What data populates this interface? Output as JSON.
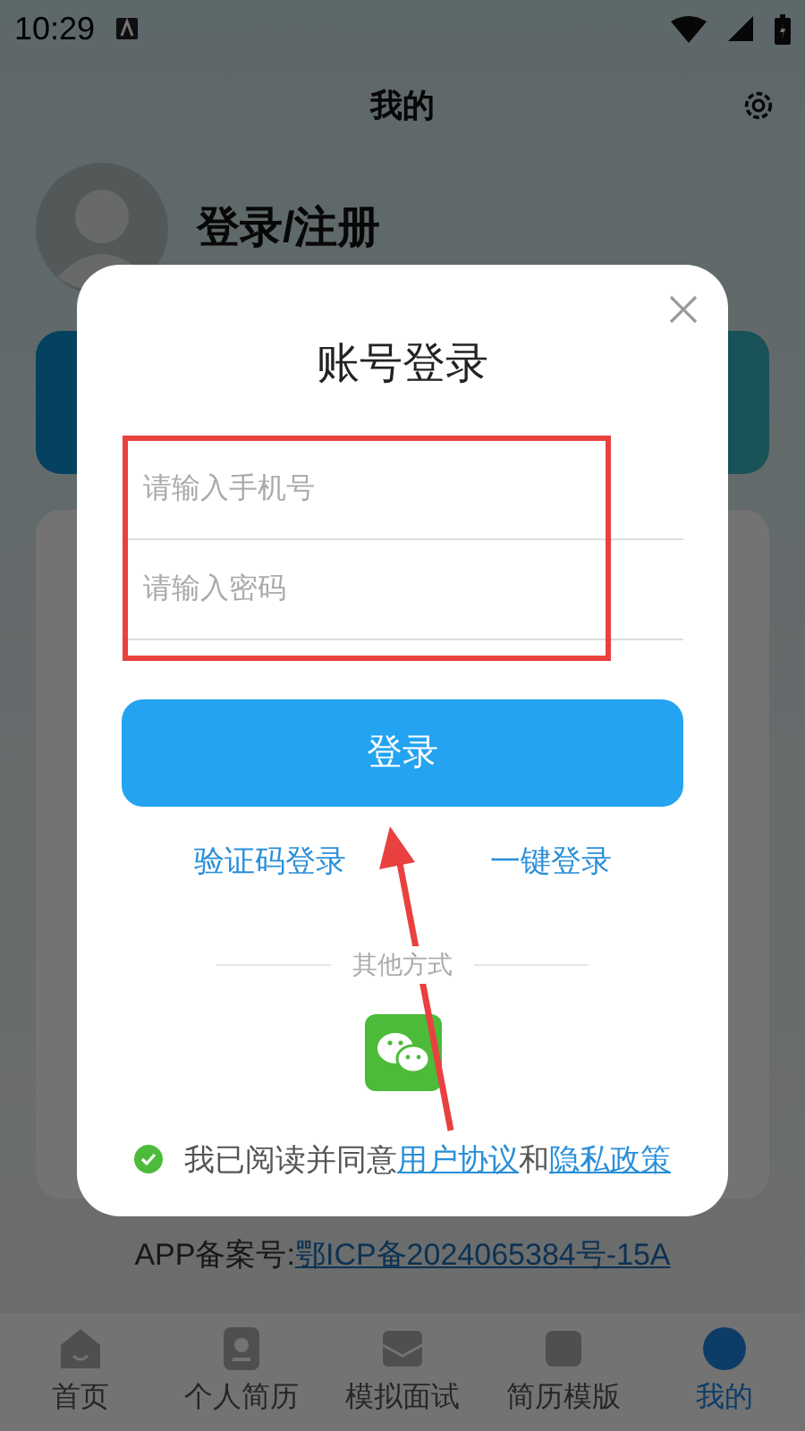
{
  "status_bar": {
    "time": "10:29"
  },
  "header": {
    "title": "我的"
  },
  "profile": {
    "name": "登录/注册"
  },
  "icp": {
    "label": "APP备案号:",
    "link": "鄂ICP备2024065384号-15A"
  },
  "nav": [
    {
      "label": "首页",
      "selected": false
    },
    {
      "label": "个人简历",
      "selected": false
    },
    {
      "label": "模拟面试",
      "selected": false
    },
    {
      "label": "简历模版",
      "selected": false
    },
    {
      "label": "我的",
      "selected": true
    }
  ],
  "dialog": {
    "title": "账号登录",
    "fields": [
      {
        "placeholder": "请输入手机号"
      },
      {
        "placeholder": "请输入密码"
      }
    ],
    "submit": "登录",
    "links": [
      "验证码登录",
      "一键登录"
    ],
    "divider": "其他方式",
    "agreement": {
      "checked": true,
      "text": "我已阅读并同意",
      "links": [
        "用户协议",
        "隐私政策"
      ],
      "joiner": "和"
    }
  },
  "annotations": {
    "highlight_box": true,
    "arrow": true
  }
}
